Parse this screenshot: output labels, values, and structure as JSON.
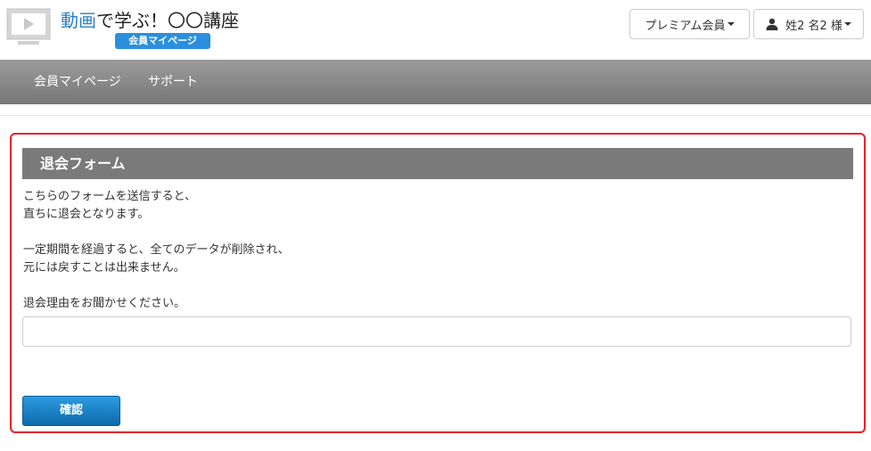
{
  "header": {
    "logo_icon": "video-play-icon",
    "title_accent": "動画",
    "title_rest": "で学ぶ！〇〇講座",
    "badge": "会員マイページ",
    "premium_button": "プレミアム会員",
    "user_button": "姓2 名2 様",
    "user_icon": "user-icon"
  },
  "nav": {
    "items": [
      {
        "label": "会員マイページ"
      },
      {
        "label": "サポート"
      }
    ]
  },
  "form": {
    "heading": "退会フォーム",
    "paragraph1": [
      "こちらのフォームを送信すると、",
      "直ちに退会となります。"
    ],
    "paragraph2": [
      "一定期間を経過すると、全てのデータが削除され、",
      "元には戻すことは出来ません。"
    ],
    "reason_label": "退会理由をお聞かせください。",
    "reason_value": "",
    "reason_placeholder": "",
    "confirm_button": "確認"
  },
  "colors": {
    "brand_blue": "#2a8fde",
    "title_accent": "#2a7ec6",
    "nav_bg": "#888888",
    "panel_border": "#e8202a",
    "heading_bg": "#7a7a7a"
  }
}
